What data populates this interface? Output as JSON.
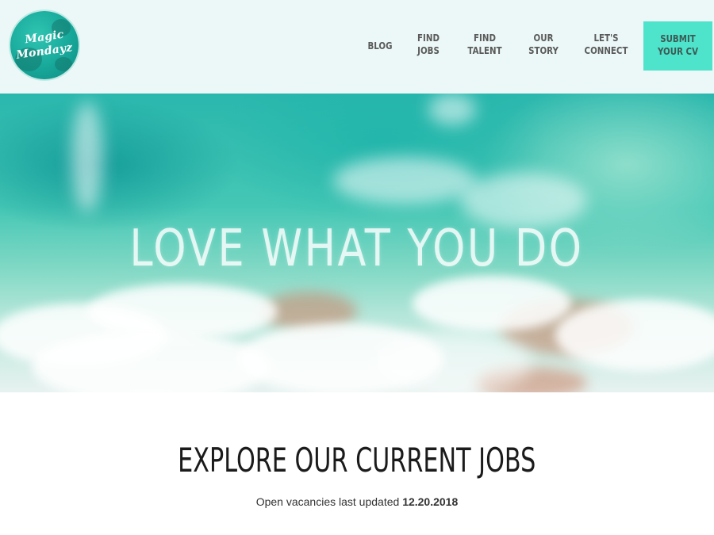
{
  "brand": {
    "logo_line1": "Magic",
    "logo_line2": "Mondayz",
    "accent_color": "#4ee3cb"
  },
  "nav": {
    "items": [
      {
        "line1": "BLOG",
        "line2": ""
      },
      {
        "line1": "FIND",
        "line2": "JOBS"
      },
      {
        "line1": "FIND",
        "line2": "TALENT"
      },
      {
        "line1": "OUR",
        "line2": "STORY"
      },
      {
        "line1": "LET'S",
        "line2": "CONNECT"
      }
    ],
    "cta": {
      "line1": "SUBMIT",
      "line2": "YOUR CV"
    }
  },
  "hero": {
    "title": "LOVE WHAT YOU DO"
  },
  "jobs": {
    "title": "EXPLORE OUR CURRENT JOBS",
    "updated_label": "Open vacancies last updated",
    "updated_date": "12.20.2018"
  }
}
